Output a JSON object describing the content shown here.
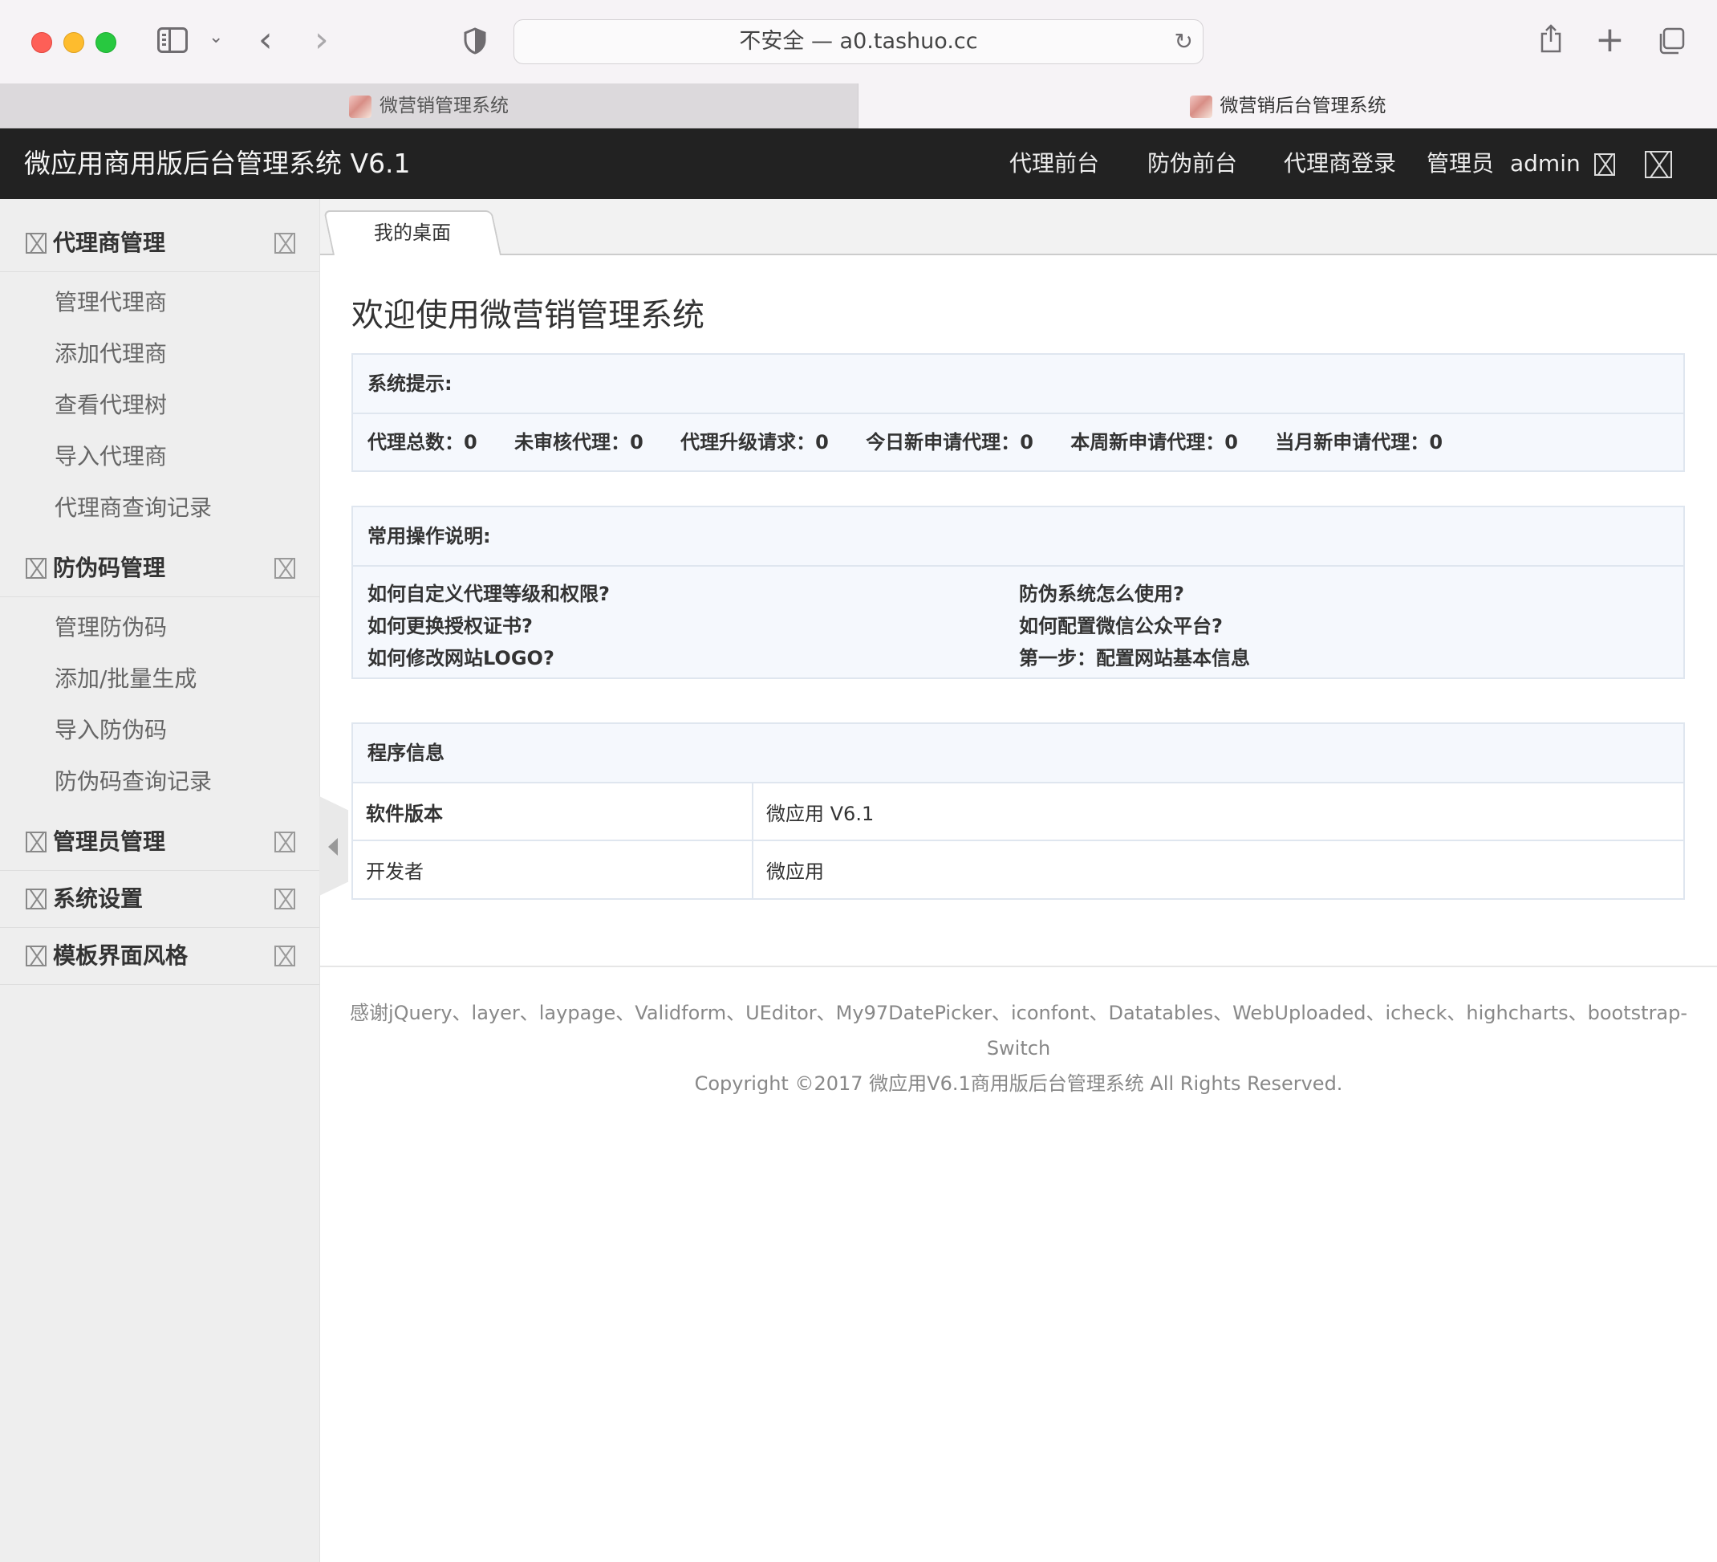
{
  "browser": {
    "address": "不安全 — a0.tashuo.cc",
    "tabs": [
      {
        "label": "微营销管理系统"
      },
      {
        "label": "微营销后台管理系统"
      }
    ]
  },
  "header": {
    "title": "微应用商用版后台管理系统 V6.1",
    "nav": [
      "代理前台",
      "防伪前台",
      "代理商登录"
    ],
    "role_label": "管理员",
    "username": "admin"
  },
  "sidebar": {
    "groups": [
      {
        "label": "代理商管理",
        "items": [
          "管理代理商",
          "添加代理商",
          "查看代理树",
          "导入代理商",
          "代理商查询记录"
        ]
      },
      {
        "label": "防伪码管理",
        "items": [
          "管理防伪码",
          "添加/批量生成",
          "导入防伪码",
          "防伪码查询记录"
        ]
      },
      {
        "label": "管理员管理",
        "items": []
      },
      {
        "label": "系统设置",
        "items": []
      },
      {
        "label": "模板界面风格",
        "items": []
      }
    ]
  },
  "main": {
    "active_tab": "我的桌面",
    "welcome": "欢迎使用微营销管理系统",
    "system_notice": {
      "title": "系统提示:",
      "stats": [
        {
          "label": "代理总数：",
          "value": "0"
        },
        {
          "label": "未审核代理：",
          "value": "0"
        },
        {
          "label": "代理升级请求：",
          "value": "0"
        },
        {
          "label": "今日新申请代理：",
          "value": "0"
        },
        {
          "label": "本周新申请代理：",
          "value": "0"
        },
        {
          "label": "当月新申请代理：",
          "value": "0"
        }
      ]
    },
    "faq": {
      "title": "常用操作说明:",
      "left": [
        "如何自定义代理等级和权限?",
        "如何更换授权证书?",
        "如何修改网站LOGO?"
      ],
      "right": [
        "防伪系统怎么使用?",
        "如何配置微信公众平台?",
        "第一步：配置网站基本信息"
      ]
    },
    "program_info": {
      "title": "程序信息",
      "rows": [
        {
          "key": "软件版本",
          "value": "微应用 V6.1"
        },
        {
          "key": "开发者",
          "value": "微应用"
        }
      ]
    }
  },
  "footer": {
    "thanks": "感谢jQuery、layer、laypage、Validform、UEditor、My97DatePicker、iconfont、Datatables、WebUploaded、icheck、highcharts、bootstrap-Switch",
    "copyright": "Copyright ©2017 微应用V6.1商用版后台管理系统 All Rights Reserved."
  }
}
